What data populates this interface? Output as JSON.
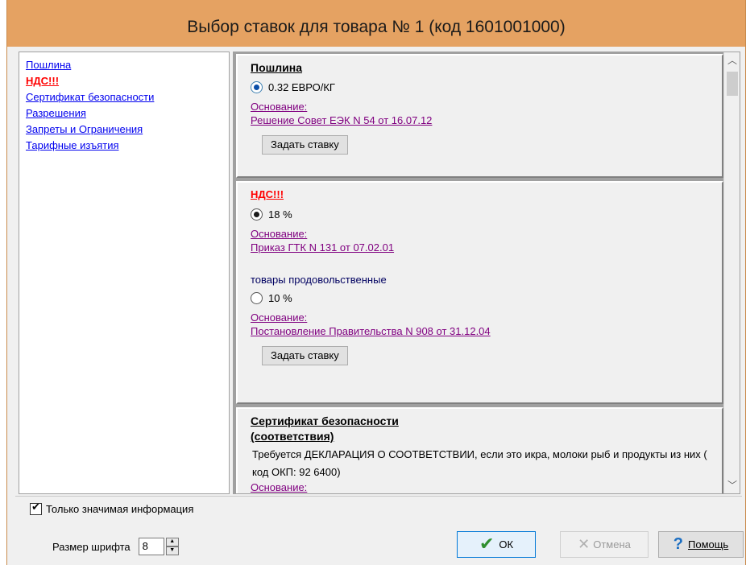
{
  "window": {
    "title": "Выбор ставок для товара № 1 (код 1601001000)"
  },
  "sidebar": {
    "items": [
      {
        "label": "Пошлина"
      },
      {
        "label": "НДС!!!"
      },
      {
        "label": "Сертификат безопасности"
      },
      {
        "label": "Разрешения"
      },
      {
        "label": "Запреты и Ограничения"
      },
      {
        "label": "Тарифные изъятия"
      }
    ]
  },
  "duty": {
    "title": "Пошлина",
    "rate": "0.32 ЕВРО/КГ",
    "basis_label": "Основание:",
    "basis_link": "Решение Совет ЕЭК N 54 от 16.07.12",
    "set_button": "Задать ставку"
  },
  "vat": {
    "title": "НДС!!!",
    "rate1": "18 %",
    "basis1_label": "Основание:",
    "basis1_link": "Приказ ГТК N 131 от 07.02.01",
    "group_label": "товары продовольственные",
    "rate2": "10 %",
    "basis2_label": "Основание:",
    "basis2_link": "Постановление Правительства N 908 от 31.12.04",
    "set_button": "Задать ставку"
  },
  "certificate": {
    "title_line1": "Сертификат безопасности",
    "title_line2": "(соответствия)",
    "text": " Требуется  ДЕКЛАРАЦИЯ О СООТВЕТСТВИИ, если это икра, молоки рыб и продукты из них ( код ОКП: 92 6400)",
    "basis_label": "Основание:"
  },
  "footer": {
    "only_important_label": "Только значимая информация",
    "font_size_label": "Размер шрифта",
    "font_size_value": "8",
    "ok_label": "ОК",
    "cancel_label": "Отмена",
    "help_label": "Помощь"
  }
}
